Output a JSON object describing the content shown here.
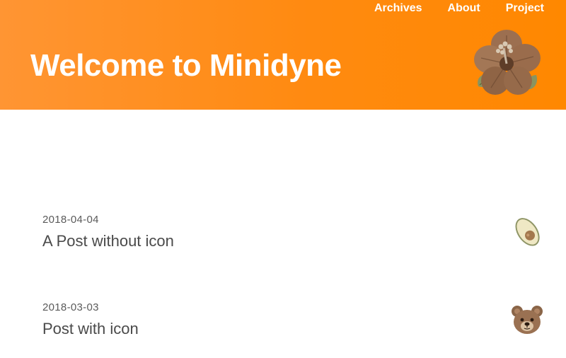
{
  "nav": {
    "items": [
      {
        "label": "Archives"
      },
      {
        "label": "About"
      },
      {
        "label": "Project"
      }
    ]
  },
  "header": {
    "title": "Welcome to Minidyne",
    "icon": "hibiscus-flower-icon",
    "background_color": "#ff8a10"
  },
  "posts": [
    {
      "date": "2018-04-04",
      "title": "A Post without icon",
      "icon": "avocado-icon"
    },
    {
      "date": "2018-03-03",
      "title": "Post with icon",
      "icon": "bear-face-icon"
    }
  ]
}
